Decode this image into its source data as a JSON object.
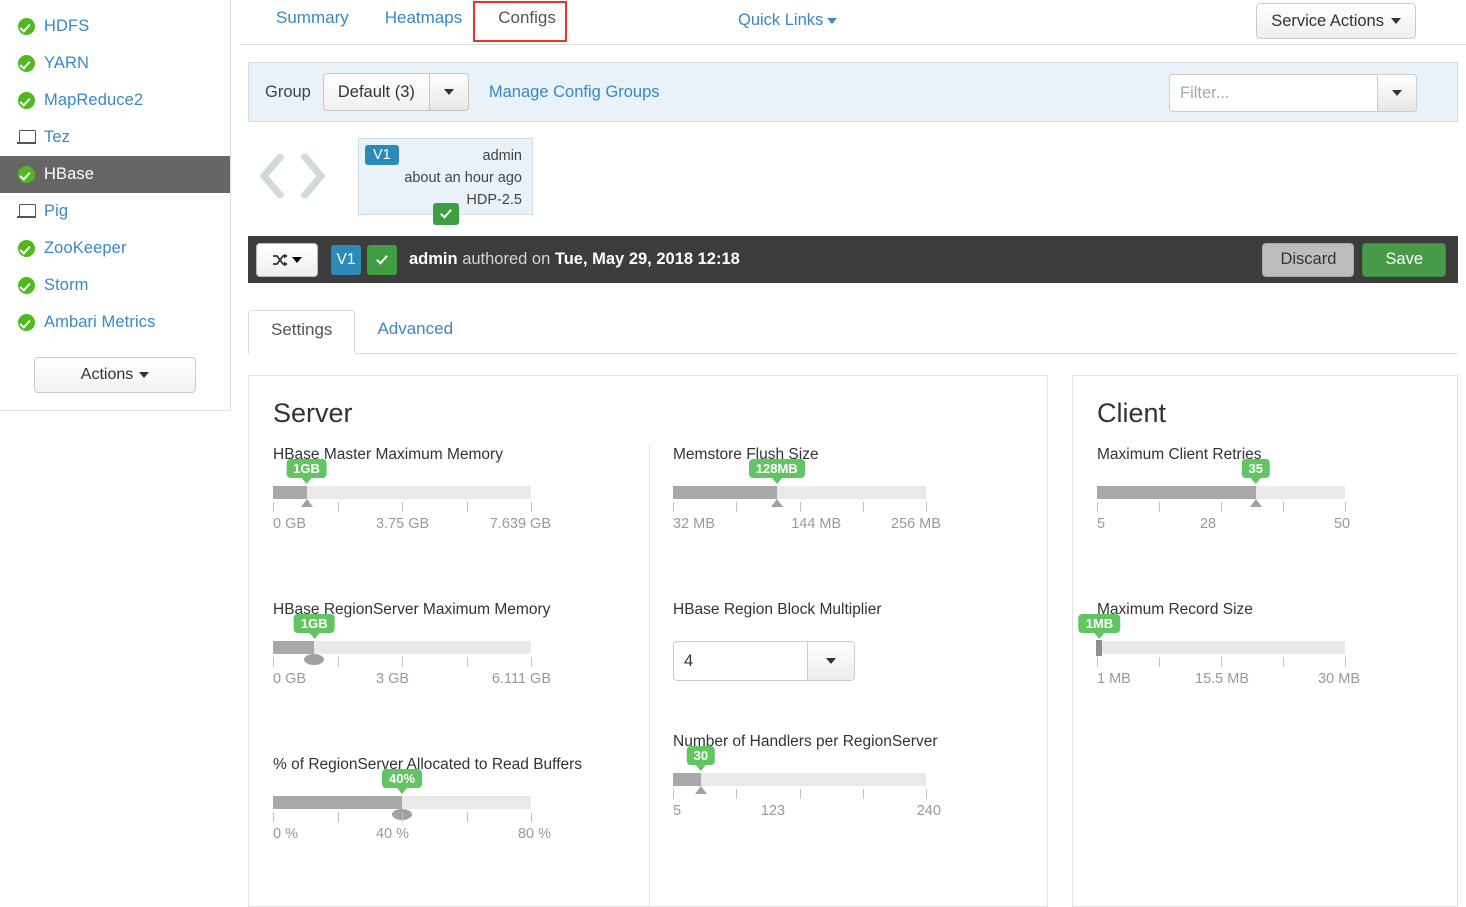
{
  "sidebar": {
    "services": [
      {
        "label": "HDFS",
        "icon": "status-ok-icon",
        "active": false
      },
      {
        "label": "YARN",
        "icon": "status-ok-icon",
        "active": false
      },
      {
        "label": "MapReduce2",
        "icon": "status-ok-icon",
        "active": false
      },
      {
        "label": "Tez",
        "icon": "client-monitor-icon",
        "active": false
      },
      {
        "label": "HBase",
        "icon": "status-ok-icon",
        "active": true
      },
      {
        "label": "Pig",
        "icon": "client-monitor-icon",
        "active": false
      },
      {
        "label": "ZooKeeper",
        "icon": "status-ok-icon",
        "active": false
      },
      {
        "label": "Storm",
        "icon": "status-ok-icon",
        "active": false
      },
      {
        "label": "Ambari Metrics",
        "icon": "status-ok-icon",
        "active": false
      }
    ],
    "actions_button": "Actions"
  },
  "nav_tabs": {
    "items": [
      {
        "label": "Summary",
        "active": false
      },
      {
        "label": "Heatmaps",
        "active": false
      },
      {
        "label": "Configs",
        "active": true
      }
    ],
    "quick_links": "Quick Links",
    "service_actions": "Service Actions",
    "highlight_color": "#e8342a"
  },
  "group_bar": {
    "label": "Group",
    "selected_group": "Default (3)",
    "manage_link": "Manage Config Groups",
    "filter_placeholder": "Filter...",
    "filter_value": ""
  },
  "version_card": {
    "badge": "V1",
    "author": "admin",
    "when": "about an hour ago",
    "stack": "HDP-2.5",
    "current": true
  },
  "action_bar": {
    "version_chip": "V1",
    "author": "admin",
    "authored_text": "authored on",
    "timestamp": "Tue, May 29, 2018 12:18",
    "discard_label": "Discard",
    "save_label": "Save",
    "compare_icon": "compare-versions-icon"
  },
  "config_tabs": [
    {
      "label": "Settings",
      "active": true
    },
    {
      "label": "Advanced",
      "active": false
    }
  ],
  "panels": {
    "server": {
      "title": "Server",
      "left_column": [
        {
          "label": "HBase Master Maximum Memory",
          "widget": "slider",
          "value_label": "1GB",
          "value_pct": 13,
          "handle": "triangle",
          "ticks_pct": [
            0,
            25,
            50,
            75,
            100
          ],
          "scale": [
            {
              "text": "0 GB",
              "pct": 0
            },
            {
              "text": "3.75 GB",
              "pct": 50
            },
            {
              "text": "7.639 GB",
              "pct": 100
            }
          ]
        },
        {
          "label": "HBase RegionServer Maximum Memory",
          "widget": "slider",
          "value_label": "1GB",
          "value_pct": 16,
          "handle": "oval",
          "ticks_pct": [
            0,
            25,
            50,
            75,
            100
          ],
          "scale": [
            {
              "text": "0 GB",
              "pct": 0
            },
            {
              "text": "3 GB",
              "pct": 50
            },
            {
              "text": "6.111 GB",
              "pct": 100
            }
          ]
        },
        {
          "label": "% of RegionServer Allocated to Read Buffers",
          "widget": "slider",
          "value_label": "40%",
          "value_pct": 50,
          "handle": "oval",
          "ticks_pct": [
            0,
            25,
            50,
            75,
            100
          ],
          "scale": [
            {
              "text": "0 %",
              "pct": 0
            },
            {
              "text": "40 %",
              "pct": 50
            },
            {
              "text": "80 %",
              "pct": 100
            }
          ]
        }
      ],
      "right_column": [
        {
          "label": "Memstore Flush Size",
          "widget": "slider",
          "value_label": "128MB",
          "value_pct": 41,
          "handle": "triangle",
          "ticks_pct": [
            0,
            25,
            50,
            75,
            100
          ],
          "scale": [
            {
              "text": "32 MB",
              "pct": 0
            },
            {
              "text": "144 MB",
              "pct": 57
            },
            {
              "text": "256 MB",
              "pct": 98
            }
          ]
        },
        {
          "label": "HBase Region Block Multiplier",
          "widget": "select",
          "value": "4"
        },
        {
          "label": "Number of Handlers per RegionServer",
          "widget": "slider",
          "value_label": "30",
          "value_pct": 11,
          "handle": "triangle",
          "ticks_pct": [
            0,
            25,
            50,
            75,
            100
          ],
          "scale": [
            {
              "text": "5",
              "pct": 0
            },
            {
              "text": "123",
              "pct": 45
            },
            {
              "text": "240",
              "pct": 98
            }
          ]
        }
      ]
    },
    "client": {
      "title": "Client",
      "properties": [
        {
          "label": "Maximum Client Retries",
          "widget": "slider",
          "value_label": "35",
          "value_pct": 64,
          "handle": "triangle",
          "ticks_pct": [
            0,
            25,
            50,
            75,
            100
          ],
          "scale": [
            {
              "text": "5",
              "pct": 0
            },
            {
              "text": "28",
              "pct": 52
            },
            {
              "text": "50",
              "pct": 94
            }
          ]
        },
        {
          "label": "Maximum Record Size",
          "widget": "slider",
          "value_label": "1MB",
          "value_pct": 1,
          "handle": "bar",
          "ticks_pct": [
            0,
            25,
            50,
            75,
            100
          ],
          "scale": [
            {
              "text": "1 MB",
              "pct": 0
            },
            {
              "text": "15.5 MB",
              "pct": 50
            },
            {
              "text": "30 MB",
              "pct": 98
            }
          ]
        }
      ]
    }
  },
  "colors": {
    "link": "#3a87c8",
    "ok_green": "#4fb91f",
    "tooltip_green": "#62c462",
    "save_green": "#479a47",
    "version_blue": "#2c8ab8",
    "dark_bar": "#3c3c3c",
    "group_bar": "#e8f2f8"
  }
}
